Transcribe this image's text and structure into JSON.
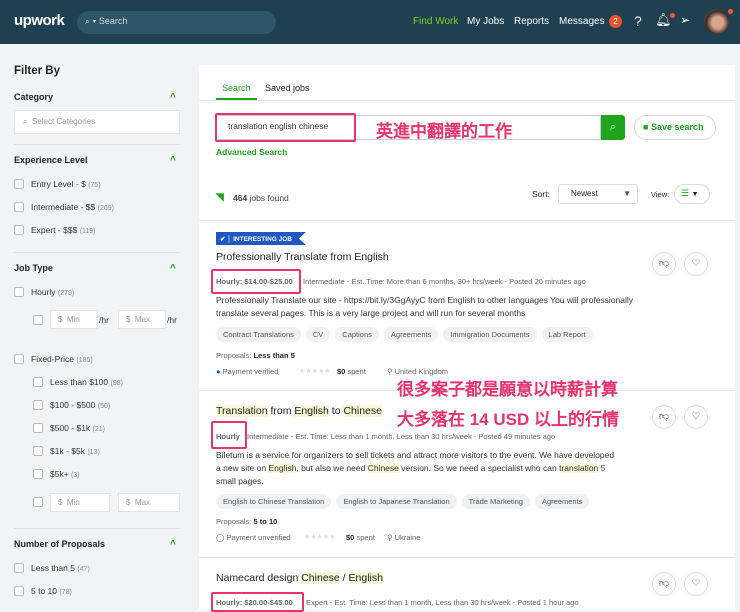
{
  "header": {
    "logo": "upwork",
    "search_placeholder": "Search",
    "nav": [
      "Find Work",
      "My Jobs",
      "Reports",
      "Messages"
    ],
    "messages_count": "2",
    "help": "?"
  },
  "sidebar": {
    "title": "Filter By",
    "category": {
      "label": "Category",
      "placeholder": "Select Categories"
    },
    "experience": {
      "label": "Experience Level",
      "items": [
        {
          "label": "Entry Level - $",
          "count": "(75)"
        },
        {
          "label": "Intermediate - $$",
          "count": "(269)"
        },
        {
          "label": "Expert - $$$",
          "count": "(119)"
        }
      ]
    },
    "job_type": {
      "label": "Job Type",
      "hourly": {
        "label": "Hourly",
        "count": "(279)"
      },
      "min": "Min",
      "max": "Max",
      "per_hr": "/hr",
      "currency": "$",
      "fixed": {
        "label": "Fixed-Price",
        "count": "(185)"
      },
      "fixed_items": [
        {
          "label": "Less than $100",
          "count": "(98)"
        },
        {
          "label": "$100 - $500",
          "count": "(50)"
        },
        {
          "label": "$500 - $1k",
          "count": "(21)"
        },
        {
          "label": "$1k - $5k",
          "count": "(13)"
        },
        {
          "label": "$5k+",
          "count": "(3)"
        }
      ]
    },
    "proposals": {
      "label": "Number of Proposals",
      "items": [
        {
          "label": "Less than 5",
          "count": "(47)"
        },
        {
          "label": "5 to 10",
          "count": "(78)"
        }
      ]
    }
  },
  "main": {
    "tabs": [
      "Search",
      "Saved jobs"
    ],
    "query": "translation english chinese",
    "save_search": "Save search",
    "advanced": "Advanced Search",
    "jobs_count": "464",
    "jobs_found": "jobs found",
    "sort_label": "Sort:",
    "sort_value": "Newest",
    "view_label": "View:"
  },
  "annotations": {
    "search": "英進中翻譯的工作",
    "line1": "很多案子都是願意以時薪計算",
    "line2": "大多落在 14 USD 以上的行情"
  },
  "jobs": [
    {
      "badge": "INTERESTING JOB",
      "title": "Professionally Translate from English",
      "rate": "Hourly: $14.00-$25.00",
      "meta": "Intermediate - Est. Time: More than 6 months, 30+ hrs/week - Posted 20 minutes ago",
      "desc": "Professionally Translate our site - https://bit.ly/3GgAyyC from English to other languages You will professionally translate several pages. This is a very large project and will run for several months",
      "tags": [
        "Contract Translations",
        "CV",
        "Captions",
        "Agreements",
        "Immigration Documents",
        "Lab Report"
      ],
      "proposals_label": "Proposals:",
      "proposals": "Less than 5",
      "payment": "Payment verified",
      "spent": "$0",
      "spent_label": "spent",
      "location": "United Kingdom"
    },
    {
      "title_parts": [
        "Translation",
        " from ",
        "English",
        " to ",
        "Chinese"
      ],
      "rate": "Hourly",
      "meta": "Intermediate - Est. Time: Less than 1 month, Less than 30 hrs/week - Posted 49 minutes ago",
      "desc_parts": [
        "Biletum is a service for organizers to sell tickets and attract more visitors to the event. We have developed a new site on ",
        "English",
        ", but also we need ",
        "Chinese",
        " version. So we need a specialist who can ",
        "translation",
        " 5 small pages."
      ],
      "tags": [
        "English to Chinese Translation",
        "English to Japanese Translation",
        "Trade Marketing",
        "Agreements"
      ],
      "proposals_label": "Proposals:",
      "proposals": "5 to 10",
      "payment": "Payment unverified",
      "spent": "$0",
      "spent_label": "spent",
      "location": "Ukraine"
    },
    {
      "title_parts": [
        "Namecard design ",
        "Chinese",
        " / ",
        "English"
      ],
      "rate": "Hourly: $20.00-$45.00",
      "meta": "Expert - Est. Time: Less than 1 month, Less than 30 hrs/week - Posted 1 hour ago"
    }
  ],
  "colors": {
    "header": "#1f4050",
    "accent": "#1ea41e",
    "annotation": "#e8336d",
    "badge": "#1f57c3"
  }
}
